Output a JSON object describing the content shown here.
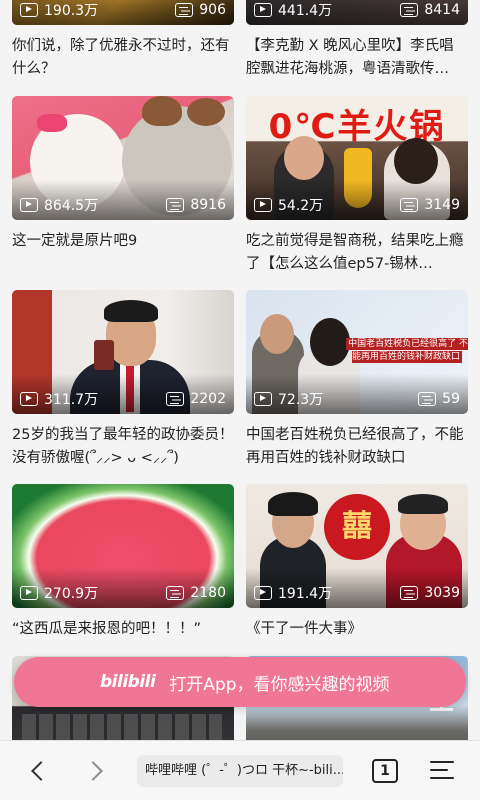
{
  "feed": [
    {
      "title": "你们说，除了优雅永不过时，还有什么？",
      "views": "190.3万",
      "danmaku": "906"
    },
    {
      "title": "【李克勤 X 晚风心里吹】李氏唱腔飘进花海桃源，粤语清歌传…",
      "views": "441.4万",
      "danmaku": "8414"
    },
    {
      "title": "这一定就是原片吧9",
      "views": "864.5万",
      "danmaku": "8916"
    },
    {
      "title": "吃之前觉得是智商税，结果吃上瘾了【怎么这么值ep57-锡林…",
      "views": "54.2万",
      "danmaku": "3149",
      "thumb_text": "0℃羊火锅"
    },
    {
      "title": "25岁的我当了最年轻的政协委员！没有骄傲喔(՞⸝⸝> ᴗ <⸝⸝՞)",
      "views": "311.7万",
      "danmaku": "2202"
    },
    {
      "title": "中国老百姓税负已经很高了，不能再用百姓的钱补财政缺口",
      "views": "72.3万",
      "danmaku": "59",
      "thumb_text": "中国老百姓税负已经很高了 不能再用百姓的钱补财政缺口"
    },
    {
      "title": "“这西瓜是来报恩的吧！！！”",
      "views": "270.9万",
      "danmaku": "2180"
    },
    {
      "title": "《干了一件大事》",
      "views": "191.4万",
      "danmaku": "3039",
      "thumb_text": "囍"
    },
    {
      "title": "",
      "views": "",
      "danmaku": ""
    },
    {
      "title": "",
      "views": "",
      "danmaku": "",
      "thumb_text": "空"
    }
  ],
  "open_app": {
    "logo": "bilibili",
    "text": "打开App，看你感兴趣的视频"
  },
  "browser": {
    "url_title": "哔哩哔哩 (゜-゜)つロ 干杯~-bili...",
    "tab_count": "1"
  }
}
